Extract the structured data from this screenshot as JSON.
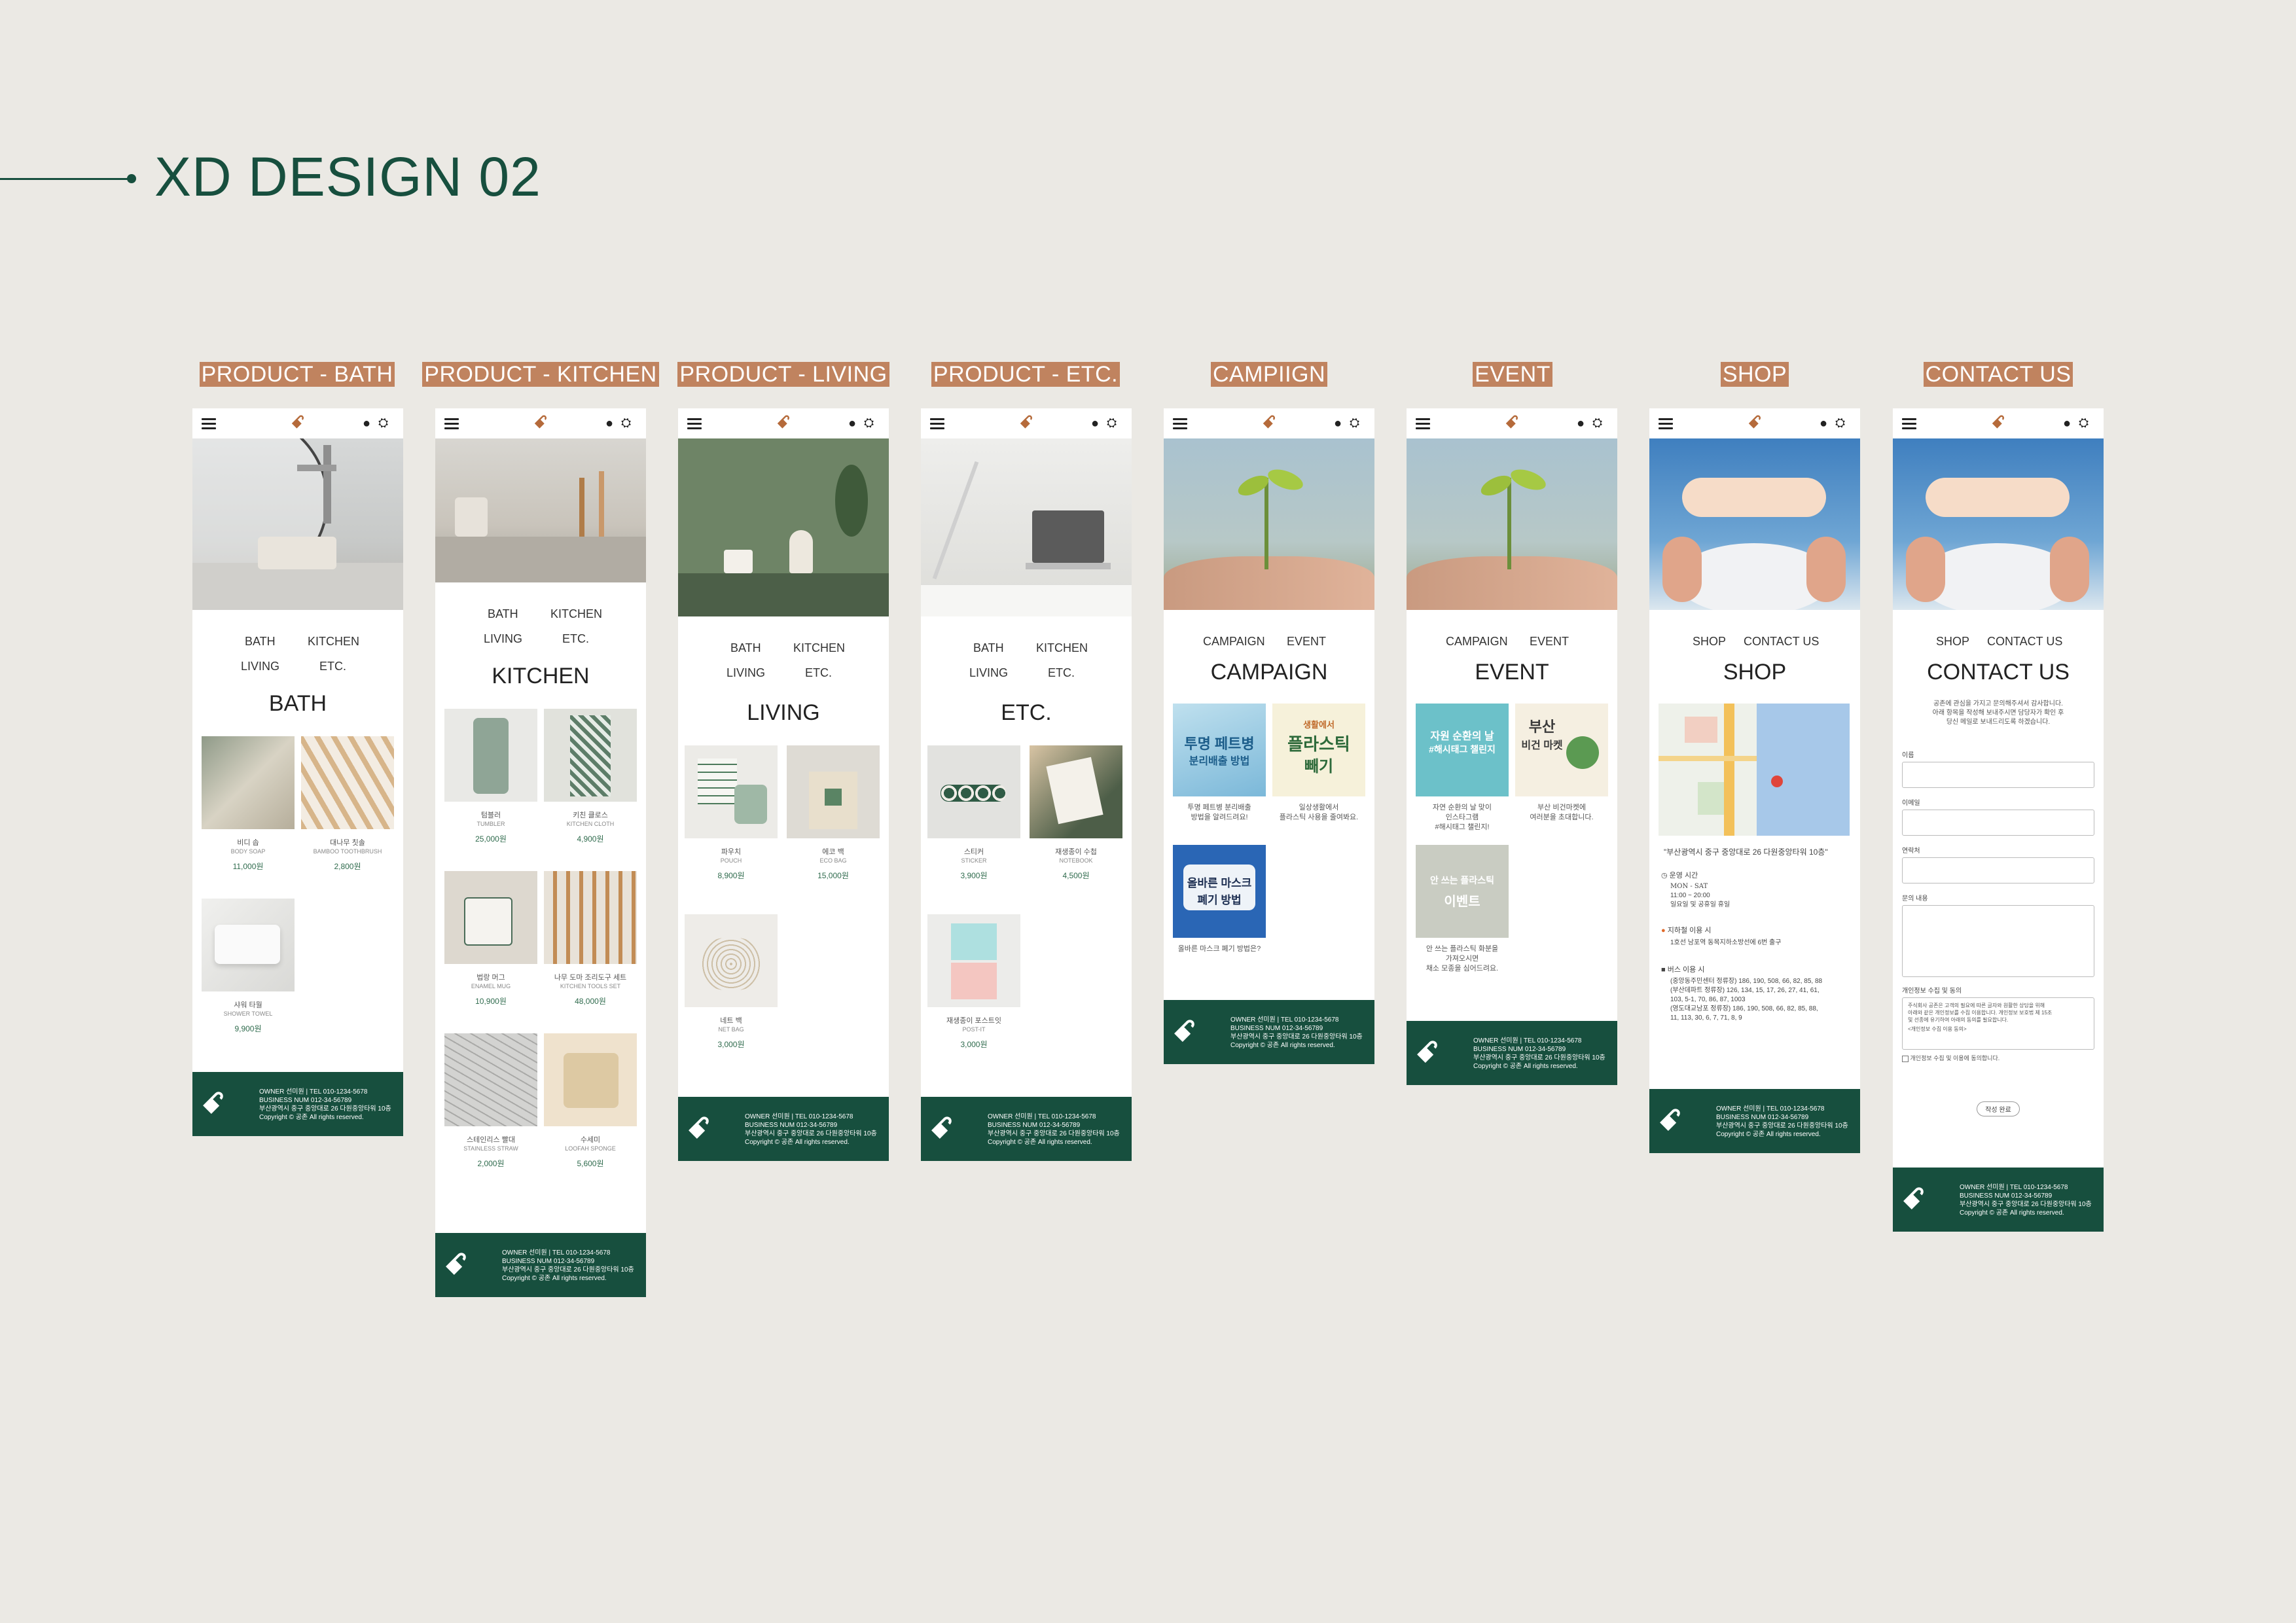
{
  "page_title": "XD DESIGN 02",
  "colors": {
    "background": "#ebe9e4",
    "brand_green": "#174f3e",
    "label_bg": "#c0835f",
    "price": "#2f6b4d"
  },
  "nav": {
    "logo_icon": "sorak-logo",
    "menu_icon": "hamburger-icon",
    "user_icon": "person-icon",
    "cart_icon": "basket-icon"
  },
  "footer": {
    "line1": "OWNER 선미원 | TEL 010-1234-5678",
    "line2": "BUSINESS NUM 012-34-56789",
    "line3": "부산광역시 중구 중앙대로 26 다원중앙타워 10층",
    "line4": "Copyright © 공존 All rights reserved."
  },
  "cat_nav": {
    "bath": "BATH",
    "kitchen": "KITCHEN",
    "living": "LIVING",
    "etc": "ETC."
  },
  "screens": [
    {
      "caption": "PRODUCT - BATH",
      "title": "BATH",
      "products": [
        {
          "name": "비디 솝",
          "en": "BODY SOAP",
          "price": "11,000원"
        },
        {
          "name": "대나무 칫솔",
          "en": "BAMBOO TOOTHBRUSH",
          "price": "2,800원"
        },
        {
          "name": "샤워 타월",
          "en": "SHOWER TOWEL",
          "price": "9,900원"
        }
      ]
    },
    {
      "caption": "PRODUCT - KITCHEN",
      "title": "KITCHEN",
      "products": [
        {
          "name": "텀블러",
          "en": "TUMBLER",
          "price": "25,000원"
        },
        {
          "name": "키친 클로스",
          "en": "KITCHEN CLOTH",
          "price": "4,900원"
        },
        {
          "name": "법랑 머그",
          "en": "ENAMEL MUG",
          "price": "10,900원"
        },
        {
          "name": "나무 도마 조리도구 세트",
          "en": "KITCHEN TOOLS SET",
          "price": "48,000원"
        },
        {
          "name": "스테인리스 빨대",
          "en": "STAINLESS STRAW",
          "price": "2,000원"
        },
        {
          "name": "수세미",
          "en": "LOOFAH SPONGE",
          "price": "5,600원"
        }
      ]
    },
    {
      "caption": "PRODUCT - LIVING",
      "title": "LIVING",
      "products": [
        {
          "name": "파우치",
          "en": "POUCH",
          "price": "8,900원"
        },
        {
          "name": "에코 백",
          "en": "ECO BAG",
          "price": "15,000원"
        },
        {
          "name": "네트 백",
          "en": "NET BAG",
          "price": "3,000원"
        }
      ]
    },
    {
      "caption": "PRODUCT - ETC.",
      "title": "ETC.",
      "products": [
        {
          "name": "스티커",
          "en": "STICKER",
          "price": "3,900원"
        },
        {
          "name": "재생종이 수첩",
          "en": "NOTEBOOK",
          "price": "4,500원"
        },
        {
          "name": "재생종이 포스트잇",
          "en": "POST-IT",
          "price": "3,000원"
        }
      ]
    },
    {
      "caption": "CAMPIIGN",
      "title": "CAMPAIGN",
      "nav_a": "CAMPAIGN",
      "nav_b": "EVENT",
      "posters": [
        {
          "title": "투명 페트병",
          "sub": "분리배출 방법",
          "cap1": "투명 페트병 분리배출",
          "cap2": "방법을 알려드려요!"
        },
        {
          "title": "플라스틱",
          "sub": "빼기",
          "top": "생활에서",
          "cap1": "일상생활에서",
          "cap2": "플라스틱 사용을 줄여봐요."
        },
        {
          "title": "올바른 마스크",
          "sub": "폐기 방법",
          "cap1": "올바른 마스크 폐기 방법은?",
          "cap2": ""
        }
      ]
    },
    {
      "caption": "EVENT",
      "title": "EVENT",
      "nav_a": "CAMPAIGN",
      "nav_b": "EVENT",
      "posters": [
        {
          "title": "자원 순환의 날",
          "sub": "#해시태그 챌린지",
          "cap1": "자연 순환의 날 맞이",
          "cap2": "인스타그램",
          "cap3": "#해시태그 챌린지!"
        },
        {
          "title": "부산",
          "sub": "비건 마켓",
          "cap1": "부산 비건마켓에",
          "cap2": "여러분을 초대합니다."
        },
        {
          "title": "안 쓰는 플라스틱",
          "sub": "이벤트",
          "cap1": "안 쓰는 플라스틱 화분을",
          "cap2": "가져오시면",
          "cap3": "채소 모종을 심어드려요."
        }
      ]
    },
    {
      "caption": "SHOP",
      "title": "SHOP",
      "nav_a": "SHOP",
      "nav_b": "CONTACT US",
      "address": "\"부산광역시 중구 중앙대로 26 다원중앙타워 10층\"",
      "hours_label": "운영 시간",
      "hours_days": "MON - SAT",
      "hours_time": "11:00 ~ 20:00",
      "hours_note": "일요일 및 공휴일 휴일",
      "subway_label": "지하철 이용 시",
      "subway_text": "1호선 남포역 동목지하소방선에 6번 출구",
      "bus_label": "버스 이용 시",
      "bus_1": "(중앙동주민센터 정류장) 186, 190, 508, 66, 82, 85, 88",
      "bus_2": "(부산데파트 정류장) 126, 134, 15, 17, 26, 27, 41, 61,",
      "bus_3": "103, 5-1, 70, 86, 87, 1003",
      "bus_4": "(영도대교남포 정류장) 186, 190, 508, 66, 82, 85, 88,",
      "bus_5": "11, 113, 30, 6, 7, 71, 8, 9"
    },
    {
      "caption": "CONTACT US",
      "title": "CONTACT US",
      "nav_a": "SHOP",
      "nav_b": "CONTACT US",
      "intro1": "공존에 관심을 가지고 문의해주셔서 감사합니다.",
      "intro2": "아래 항목을 작성해 보내주시면 담당자가 확인 후",
      "intro3": "당신 메일로 보내드리도록 하겠습니다.",
      "f_name": "이름",
      "f_email": "이메일",
      "f_phone": "연락처",
      "f_msg": "문의 내용",
      "f_privacy": "개인정보 수집 및 동의",
      "privacy1": "주식회사 공존은 고객의 필요에 따른 글자와 원활한 상담을 위해",
      "privacy2": "아래와 같은 개인정보를 수집 이용합니다. 개인정보 보호법 제 15조",
      "privacy3": "및 선종에 유기하여 아래의 동의를 필요합니다.",
      "privacy4": "<개인정보 수집 이용 동의>",
      "agree": "개인정보 수집 및 이용에 동의합니다.",
      "submit": "작성 완료"
    }
  ]
}
